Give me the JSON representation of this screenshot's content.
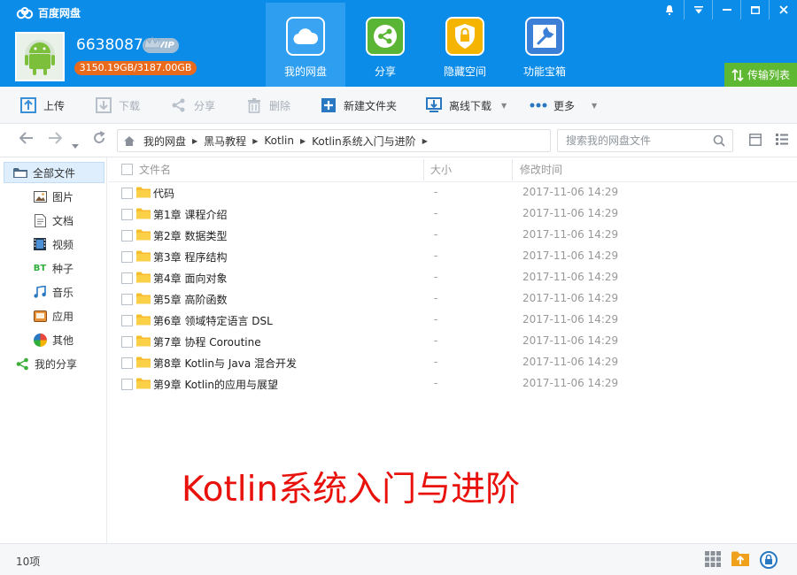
{
  "app": {
    "title": "百度网盘"
  },
  "user": {
    "name": "6638087",
    "vip": "VIP",
    "quota": "3150.19GB/3187.00GB"
  },
  "nav_tabs": [
    {
      "label": "我的网盘",
      "icon": "cloud-icon",
      "color": "#3aa3f2"
    },
    {
      "label": "分享",
      "icon": "share-icon",
      "color": "#5ab534"
    },
    {
      "label": "隐藏空间",
      "icon": "lock-icon",
      "color": "#f4b400"
    },
    {
      "label": "功能宝箱",
      "icon": "wrench-icon",
      "color": "#3b7fd6"
    }
  ],
  "transfer_label": "传输列表",
  "toolbar": {
    "upload": "上传",
    "download": "下载",
    "share": "分享",
    "delete": "删除",
    "new_folder": "新建文件夹",
    "offline_download": "离线下载",
    "more": "更多"
  },
  "breadcrumb": [
    "我的网盘",
    "黑马教程",
    "Kotlin",
    "Kotlin系统入门与进阶"
  ],
  "search": {
    "placeholder": "搜索我的网盘文件"
  },
  "sidebar": [
    {
      "label": "全部文件",
      "icon": "folder-icon"
    },
    {
      "label": "图片",
      "icon": "image-icon"
    },
    {
      "label": "文档",
      "icon": "document-icon"
    },
    {
      "label": "视频",
      "icon": "video-icon"
    },
    {
      "label": "种子",
      "icon": "bt-icon"
    },
    {
      "label": "音乐",
      "icon": "music-icon"
    },
    {
      "label": "应用",
      "icon": "app-icon"
    },
    {
      "label": "其他",
      "icon": "other-icon"
    },
    {
      "label": "我的分享",
      "icon": "share-icon"
    }
  ],
  "columns": {
    "name": "文件名",
    "size": "大小",
    "modified": "修改时间"
  },
  "files": [
    {
      "name": "代码",
      "size": "-",
      "modified": "2017-11-06 14:29"
    },
    {
      "name": "第1章 课程介绍",
      "size": "-",
      "modified": "2017-11-06 14:29"
    },
    {
      "name": "第2章 数据类型",
      "size": "-",
      "modified": "2017-11-06 14:29"
    },
    {
      "name": "第3章 程序结构",
      "size": "-",
      "modified": "2017-11-06 14:29"
    },
    {
      "name": "第4章 面向对象",
      "size": "-",
      "modified": "2017-11-06 14:29"
    },
    {
      "name": "第5章 高阶函数",
      "size": "-",
      "modified": "2017-11-06 14:29"
    },
    {
      "name": "第6章 领域特定语言 DSL",
      "size": "-",
      "modified": "2017-11-06 14:29"
    },
    {
      "name": "第7章 协程 Coroutine",
      "size": "-",
      "modified": "2017-11-06 14:29"
    },
    {
      "name": "第8章 Kotlin与 Java 混合开发",
      "size": "-",
      "modified": "2017-11-06 14:29"
    },
    {
      "name": "第9章 Kotlin的应用与展望",
      "size": "-",
      "modified": "2017-11-06 14:29"
    }
  ],
  "overlay_text": "Kotlin系统入门与进阶",
  "status": {
    "count": "10项"
  }
}
